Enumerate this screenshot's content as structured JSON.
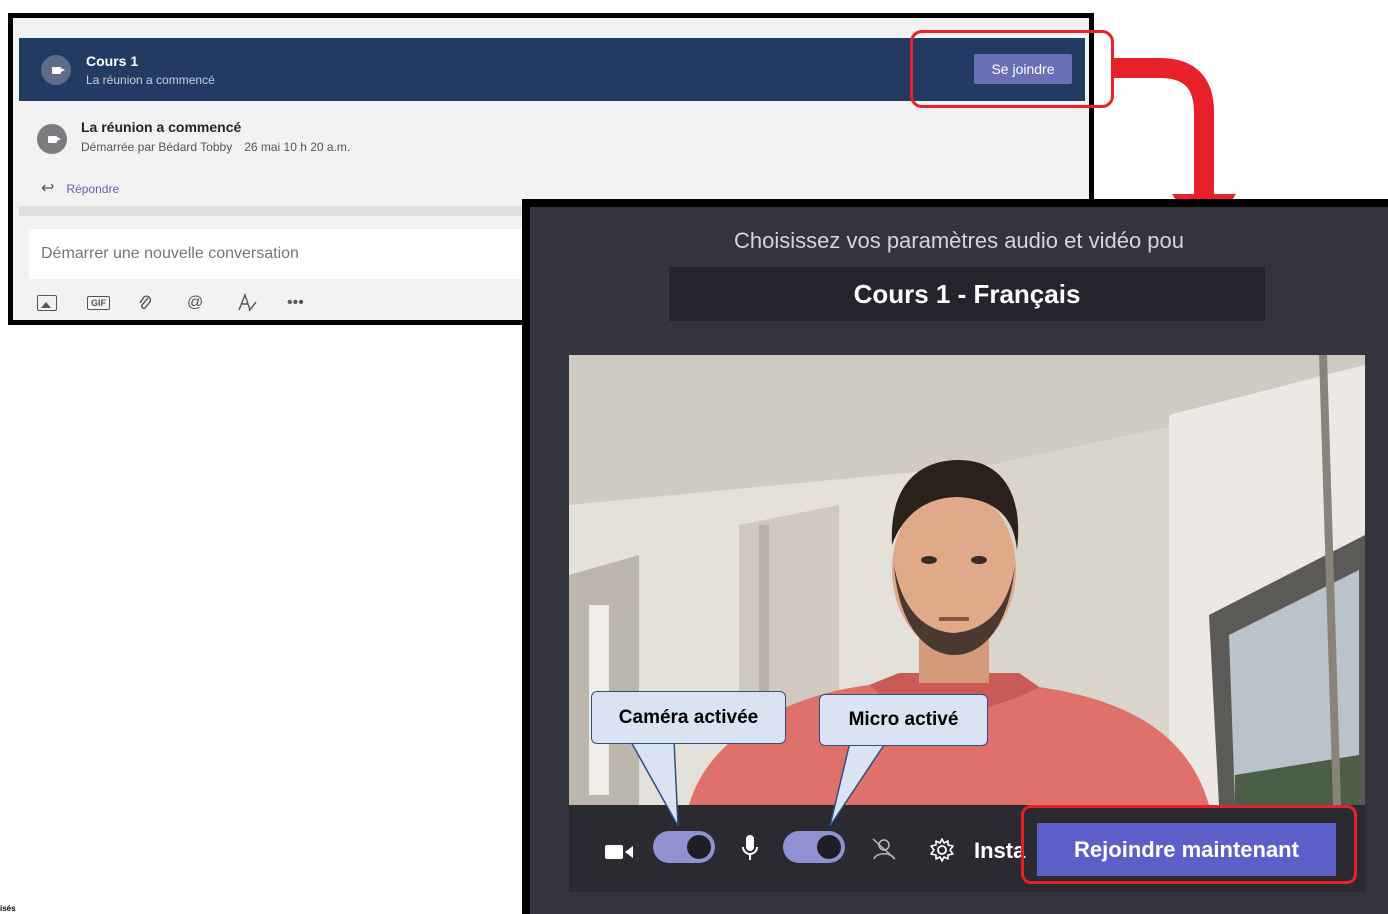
{
  "chat": {
    "banner_title": "Cours 1",
    "banner_subtitle": "La réunion a commencé",
    "join_button": "Se joindre",
    "message_title": "La réunion a commencé",
    "message_subtitle": "Démarrée par Bédard Tobby",
    "message_date": "26 mai 10 h 20 a.m.",
    "reply_label": "Répondre",
    "compose_placeholder": "Démarrer une nouvelle conversation",
    "toolbar_icons": [
      "image-icon",
      "gif-icon",
      "attach-icon",
      "mention-icon",
      "format-icon",
      "more-icon"
    ]
  },
  "prejoin": {
    "heading": "Choisissez vos paramètres audio et vidéo pou",
    "meeting_name": "Cours 1 - Français",
    "device_settings_label": "Insta",
    "join_now_button": "Rejoindre maintenant",
    "camera_toggle_on": true,
    "mic_toggle_on": true
  },
  "callouts": {
    "camera": "Caméra activée",
    "mic": "Micro activé"
  },
  "corner_text": "isés",
  "colors": {
    "banner": "#233b63",
    "accent": "#6264a7",
    "highlight": "#e8202a",
    "dialog_bg": "#33343d",
    "callout_fill": "#dae3f3"
  }
}
